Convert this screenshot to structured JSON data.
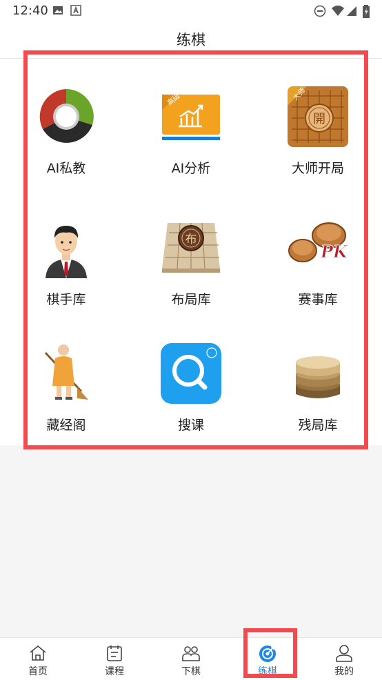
{
  "status_bar": {
    "time": "12:40",
    "icons": [
      "image-icon",
      "a-icon",
      "dnd-icon",
      "wifi-icon",
      "signal-icon",
      "battery-icon"
    ]
  },
  "header": {
    "title": "练棋"
  },
  "grid": {
    "items": [
      {
        "label": "AI私教",
        "icon": "ai-tutor-icon"
      },
      {
        "label": "AI分析",
        "icon": "ai-analysis-icon"
      },
      {
        "label": "大师开局",
        "icon": "master-opening-icon"
      },
      {
        "label": "棋手库",
        "icon": "player-library-icon"
      },
      {
        "label": "布局库",
        "icon": "opening-library-icon"
      },
      {
        "label": "赛事库",
        "icon": "match-library-icon"
      },
      {
        "label": "藏经阁",
        "icon": "scripture-library-icon"
      },
      {
        "label": "搜课",
        "icon": "search-course-icon"
      },
      {
        "label": "残局库",
        "icon": "endgame-library-icon"
      }
    ],
    "badges": {
      "ai_analysis": "高级",
      "master": "大师",
      "master_piece": "開",
      "layout_piece": "布",
      "pk": "PK"
    }
  },
  "bottom_nav": {
    "items": [
      {
        "label": "首页",
        "icon": "home-icon"
      },
      {
        "label": "课程",
        "icon": "calendar-icon"
      },
      {
        "label": "下棋",
        "icon": "users-icon"
      },
      {
        "label": "练棋",
        "icon": "target-icon",
        "active": true
      },
      {
        "label": "我的",
        "icon": "person-icon"
      }
    ]
  },
  "colors": {
    "accent": "#1e88e5",
    "highlight": "#f24a4f"
  }
}
